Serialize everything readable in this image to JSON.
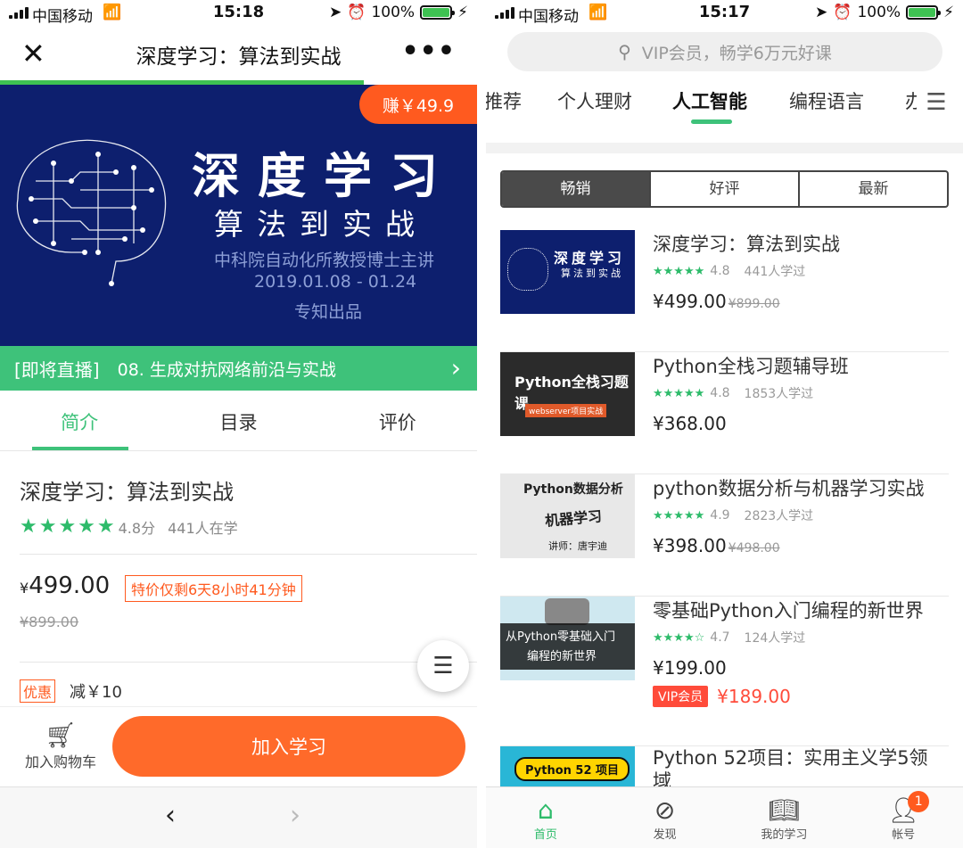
{
  "left": {
    "status": {
      "carrier": "中国移动",
      "time": "15:18",
      "battery": "100%"
    },
    "nav": {
      "title": "深度学习：算法到实战",
      "close": "✕",
      "more": "•••"
    },
    "banner": {
      "earn": "赚￥49.9",
      "line1": "深度学习",
      "line2": "算法到实战",
      "line3": "中科院自动化所教授博士主讲",
      "line4": "2019.01.08 - 01.24",
      "line5": "专知出品"
    },
    "live": {
      "tag": "[即将直播]",
      "text": "08. 生成对抗网络前沿与实战"
    },
    "tabs": [
      "简介",
      "目录",
      "评价"
    ],
    "course": {
      "title": "深度学习：算法到实战",
      "score": "4.8分",
      "learners": "441人在学",
      "currency": "¥",
      "price": "499.00",
      "promo": "特价仅剩6天8小时41分钟",
      "old_price": "¥899.00",
      "discount_tag": "优惠",
      "discount_text": "减￥10"
    },
    "actions": {
      "cart": "加入购物车",
      "join": "加入学习"
    }
  },
  "right": {
    "status": {
      "carrier": "中国移动",
      "time": "15:17",
      "battery": "100%"
    },
    "search_placeholder": "VIP会员，畅学6万元好课",
    "categories": [
      "推荐",
      "个人理财",
      "人工智能",
      "编程语言",
      "办"
    ],
    "segments": [
      "畅销",
      "好评",
      "最新"
    ],
    "items": [
      {
        "title": "深度学习：算法到实战",
        "score": "4.8",
        "learners": "441人学过",
        "price": "¥499.00",
        "old": "¥899.00",
        "thumb_a": "深度学习",
        "thumb_b": "算法到实战"
      },
      {
        "title": "Python全栈习题辅导班",
        "score": "4.8",
        "learners": "1853人学过",
        "price": "¥368.00",
        "old": "",
        "thumb_a": "Python全栈习题课",
        "thumb_b": "webserver项目实战"
      },
      {
        "title": "python数据分析与机器学习实战",
        "score": "4.9",
        "learners": "2823人学过",
        "price": "¥398.00",
        "old": "¥498.00",
        "thumb_a": "Python数据分析",
        "thumb_b": "讲师：唐宇迪"
      },
      {
        "title": "零基础Python入门编程的新世界",
        "score": "4.7",
        "learners": "124人学过",
        "price": "¥199.00",
        "old": "",
        "thumb_a": "从Python零基础入门",
        "thumb_b": "编程的新世界",
        "vip_badge": "VIP会员",
        "vip_price": "¥189.00"
      },
      {
        "title": "Python 52项目：实用主义学5领域",
        "thumb_a": "Python 52 项目"
      }
    ],
    "tabbar": [
      "首页",
      "发现",
      "我的学习",
      "帐号"
    ],
    "notif": "1"
  },
  "colors": {
    "accent": "#3ec27a",
    "orange": "#ff6a2a",
    "banner": "#0d1f6e"
  }
}
